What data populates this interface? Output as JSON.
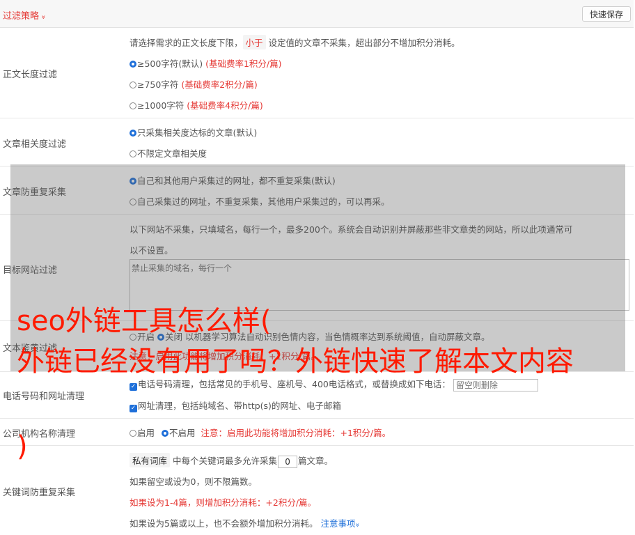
{
  "header": {
    "strategy_label": "过滤策略",
    "strategy_chevron": "»",
    "save_label": "快速保存"
  },
  "body_length": {
    "label": "正文长度过滤",
    "desc_before": "请选择需求的正文长度下限，",
    "desc_chip": "小于",
    "desc_after": "设定值的文章不采集，超出部分不增加积分消耗。",
    "options": [
      {
        "text": "≥500字符(默认)",
        "note": "(基础费率1积分/篇)",
        "selected": true
      },
      {
        "text": "≥750字符",
        "note": "(基础费率2积分/篇)",
        "selected": false
      },
      {
        "text": "≥1000字符",
        "note": "(基础费率4积分/篇)",
        "selected": false
      }
    ]
  },
  "relevance": {
    "label": "文章相关度过滤",
    "options": [
      {
        "text": "只采集相关度达标的文章(默认)",
        "selected": true
      },
      {
        "text": "不限定文章相关度",
        "selected": false
      }
    ]
  },
  "dedupe": {
    "label": "文章防重复采集",
    "options": [
      {
        "text": "自己和其他用户采集过的网址，都不重复采集(默认)",
        "selected": true
      },
      {
        "text": "自己采集过的网址，不重复采集，其他用户采集过的，可以再采。",
        "selected": false
      }
    ]
  },
  "site_filter": {
    "label": "目标网站过滤",
    "desc_line1": "以下网站不采集，只填域名，每行一个，最多200个。系统会自动识别并屏蔽那些非文章类的网站，所以此项通常可",
    "desc_line2": "以不设置。",
    "placeholder": "禁止采集的域名，每行一个"
  },
  "content_review": {
    "label": "文本鉴黄过滤",
    "on_label": "开启",
    "off_label": "关闭",
    "selected": "off",
    "desc": "以机器学习算法自动识别色情内容，当色情概率达到系统阈值，自动屏蔽文章。",
    "note": "注意：启用此功能将增加积分消耗：+1积分/篇。"
  },
  "phone_url": {
    "label": "电话号码和网址清理",
    "phone_text": "电话号码清理，包括常见的手机号、座机号、400电话格式，或替换成如下电话：",
    "phone_placeholder": "留空则删除",
    "url_text": "网址清理，包括纯域名、带http(s)的网址、电子邮箱",
    "phone_checked": true,
    "url_checked": true
  },
  "org_name": {
    "label": "公司机构名称清理",
    "on_label": "启用",
    "off_label": "不启用",
    "selected": "off",
    "note": "注意：启用此功能将增加积分消耗：+1积分/篇。"
  },
  "keyword_dedupe": {
    "label": "关键词防重复采集",
    "chip": "私有词库",
    "text_before": "中每个关键词最多允许采集",
    "value": "0",
    "text_after": "篇文章。",
    "line2": "如果留空或设为0，则不限篇数。",
    "line3": "如果设为1-4篇，则增加积分消耗：+2积分/篇。",
    "line4": "如果设为5篇或以上，也不会额外增加积分消耗。",
    "notice_link": "注意事项",
    "notice_chevron": "»"
  },
  "watermark": {
    "line1": "seo外链工具怎么样(",
    "line2": "外链已经没有用了吗？外链快速了解本文内容",
    "line3": ")"
  },
  "colors": {
    "accent_red": "#e53935",
    "link_blue": "#1e6fd9",
    "overlay_gray": "#5a5a5a",
    "watermark_red": "#ff1a00"
  }
}
